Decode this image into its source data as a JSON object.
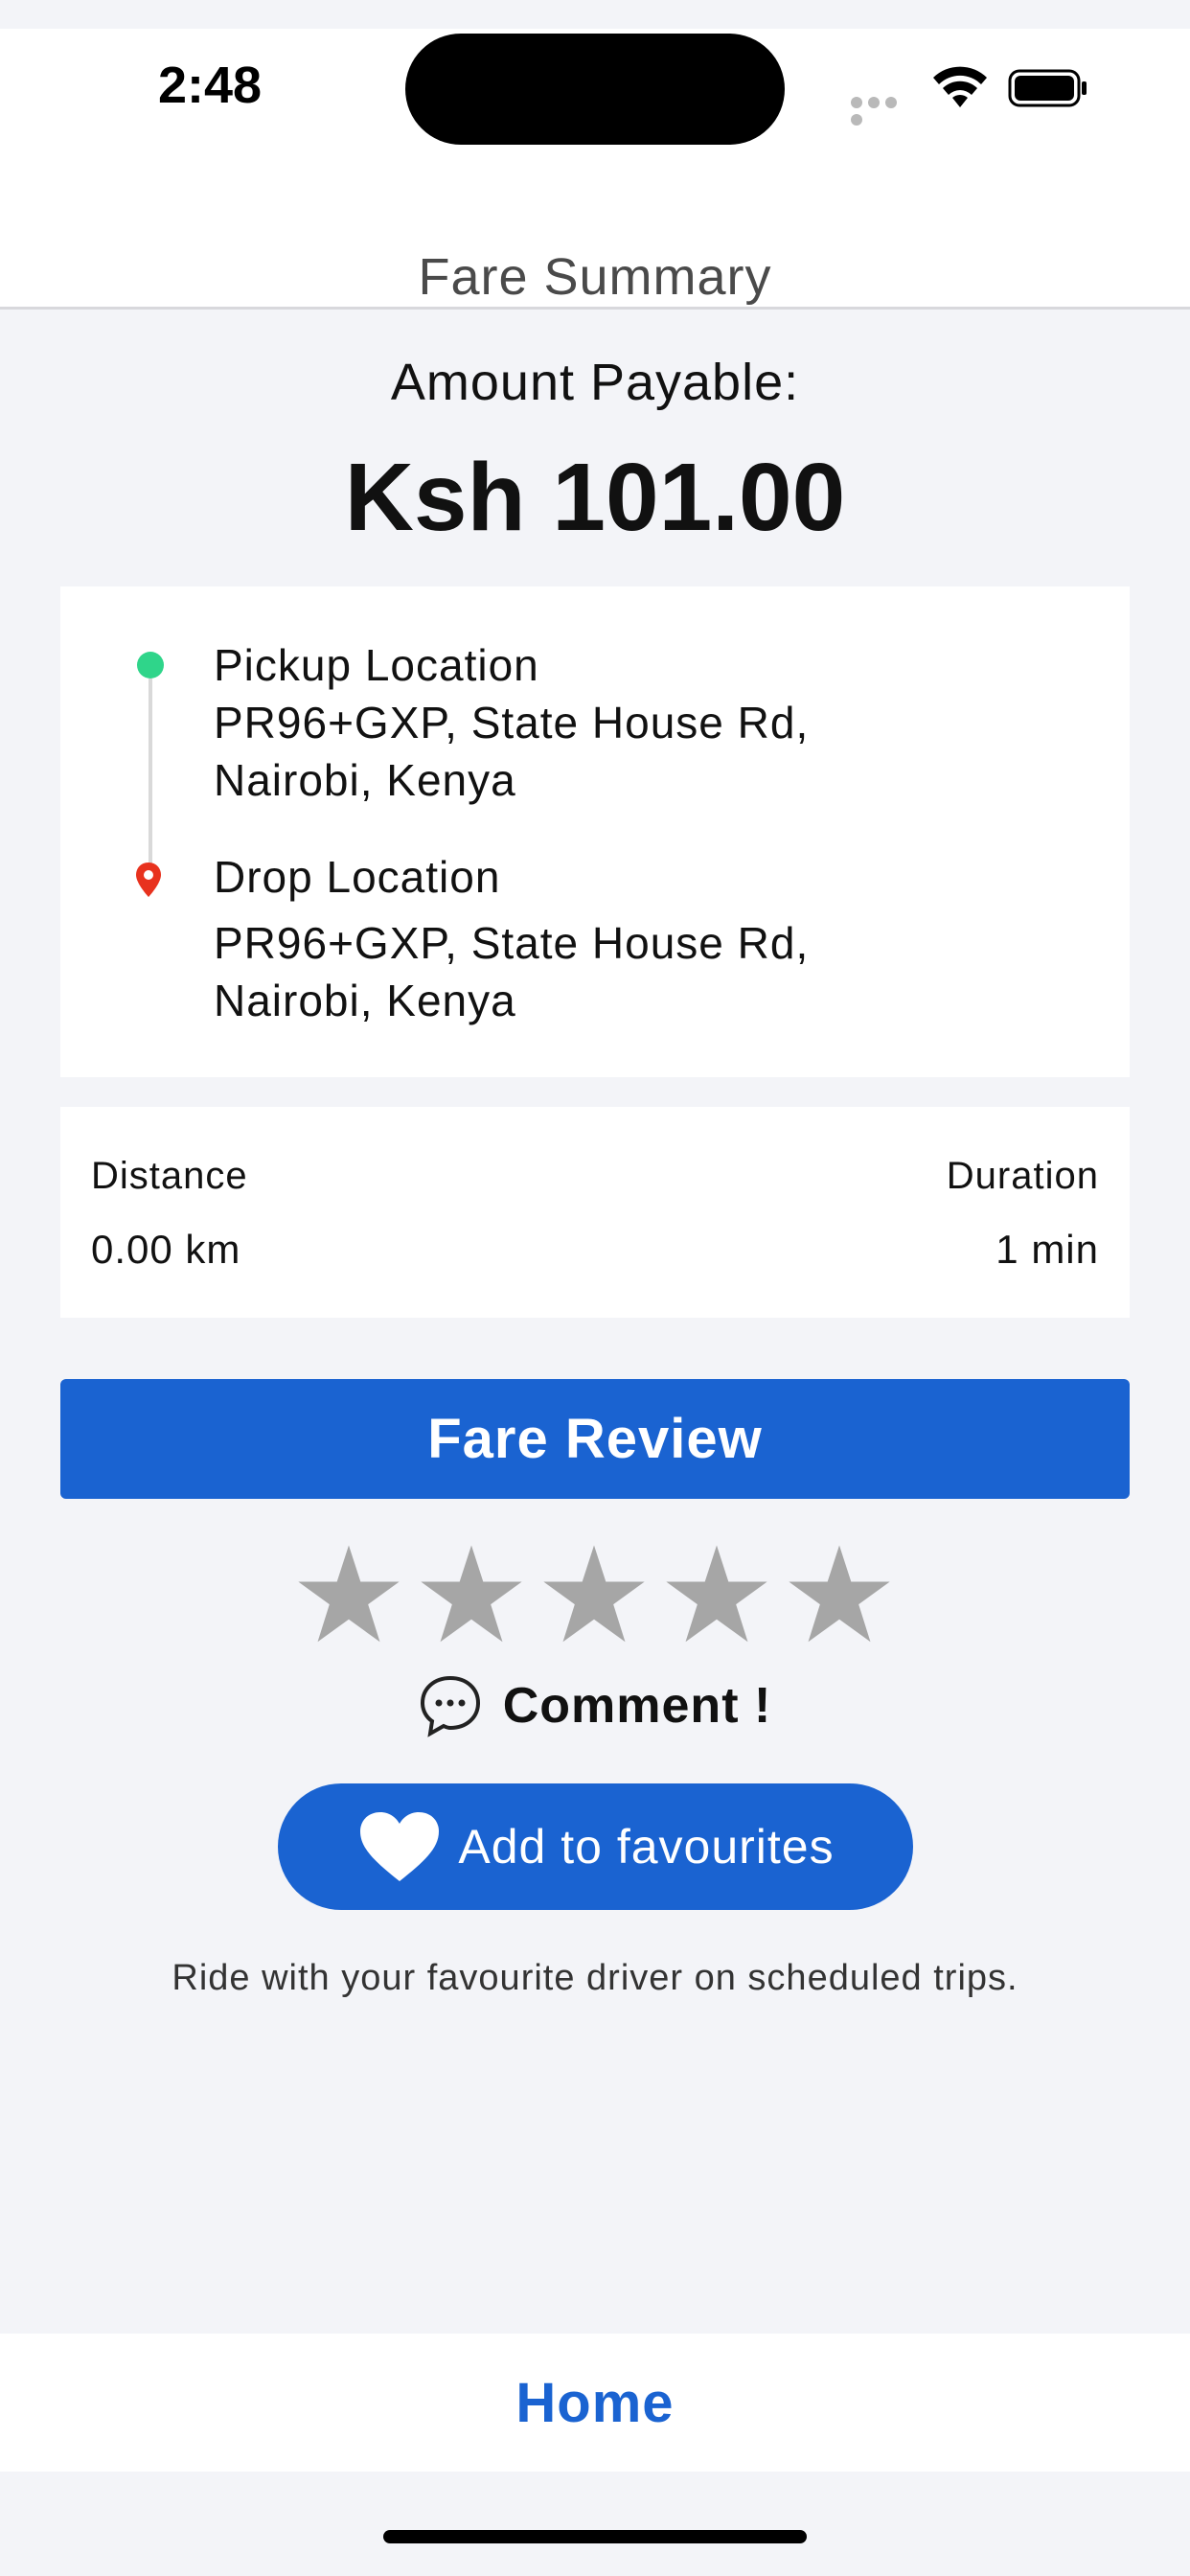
{
  "status_bar": {
    "time": "2:48"
  },
  "header": {
    "title": "Fare Summary"
  },
  "amount": {
    "label": "Amount Payable:",
    "value": "Ksh 101.00"
  },
  "locations": {
    "pickup": {
      "title": "Pickup Location",
      "address_line1": "PR96+GXP, State House Rd,",
      "address_line2": "Nairobi, Kenya"
    },
    "drop": {
      "title": "Drop Location",
      "address_line1": "PR96+GXP, State House Rd,",
      "address_line2": "Nairobi, Kenya"
    }
  },
  "trip": {
    "distance_label": "Distance",
    "distance_value": "0.00 km",
    "duration_label": "Duration",
    "duration_value": "1 min"
  },
  "fare_review": {
    "label": "Fare Review"
  },
  "rating": {
    "value": 0,
    "max": 5
  },
  "comment": {
    "label": "Comment !"
  },
  "favourites": {
    "button_label": "Add to favourites",
    "hint": "Ride with your favourite driver on scheduled trips."
  },
  "bottom": {
    "home_label": "Home"
  },
  "colors": {
    "primary": "#1a63d1",
    "pickup_dot": "#2fd58a",
    "drop_pin": "#e8321e",
    "star_inactive": "#a6a6a6",
    "background": "#f3f4f8"
  }
}
